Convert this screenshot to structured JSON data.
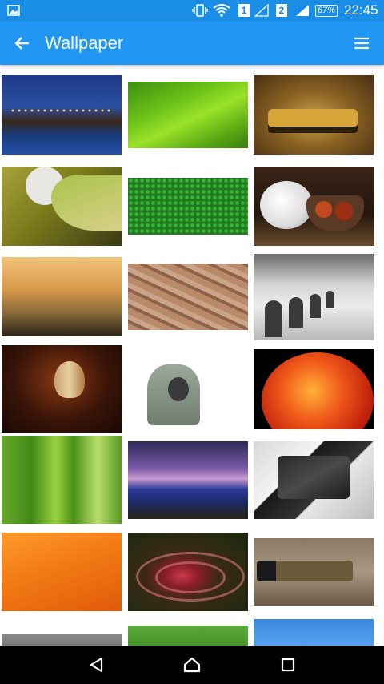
{
  "status_bar": {
    "sim1": "1",
    "sim2": "2",
    "battery": "67%",
    "time": "22:45"
  },
  "app_bar": {
    "title": "Wallpaper"
  },
  "wallpapers": [
    {
      "subject": "canal at night"
    },
    {
      "subject": "green leaf"
    },
    {
      "subject": "vintage car"
    },
    {
      "subject": "gecko foot"
    },
    {
      "subject": "green grass"
    },
    {
      "subject": "white flowers and fruit bowl"
    },
    {
      "subject": "misty sunrise hills"
    },
    {
      "subject": "old town rooftops"
    },
    {
      "subject": "row of arches"
    },
    {
      "subject": "leaf on wood"
    },
    {
      "subject": "hooded man"
    },
    {
      "subject": "fiery planet"
    },
    {
      "subject": "green grass blades"
    },
    {
      "subject": "purple sky field"
    },
    {
      "subject": "jigsaw puzzle woman"
    },
    {
      "subject": "orange gradient"
    },
    {
      "subject": "red flower ripples"
    },
    {
      "subject": "camera with bird"
    },
    {
      "subject": "grey landscape"
    },
    {
      "subject": "green lawn"
    },
    {
      "subject": "blue sky"
    }
  ],
  "nav_bar": {
    "buttons": [
      "back",
      "home",
      "recents"
    ]
  }
}
